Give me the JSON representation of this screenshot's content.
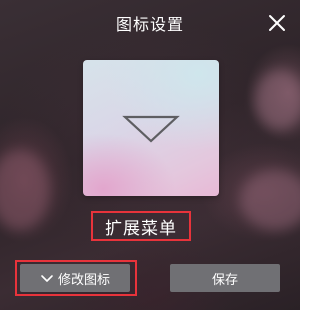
{
  "dialog": {
    "title": "图标设置",
    "close_icon": "close-icon"
  },
  "preview": {
    "icon": "triangle-down-icon",
    "name": "扩展菜单"
  },
  "actions": {
    "edit_label": "修改图标",
    "edit_icon": "chevron-down-icon",
    "save_label": "保存"
  },
  "colors": {
    "highlight": "#e8333b",
    "button_bg": "#707074",
    "text": "#ffffff"
  }
}
